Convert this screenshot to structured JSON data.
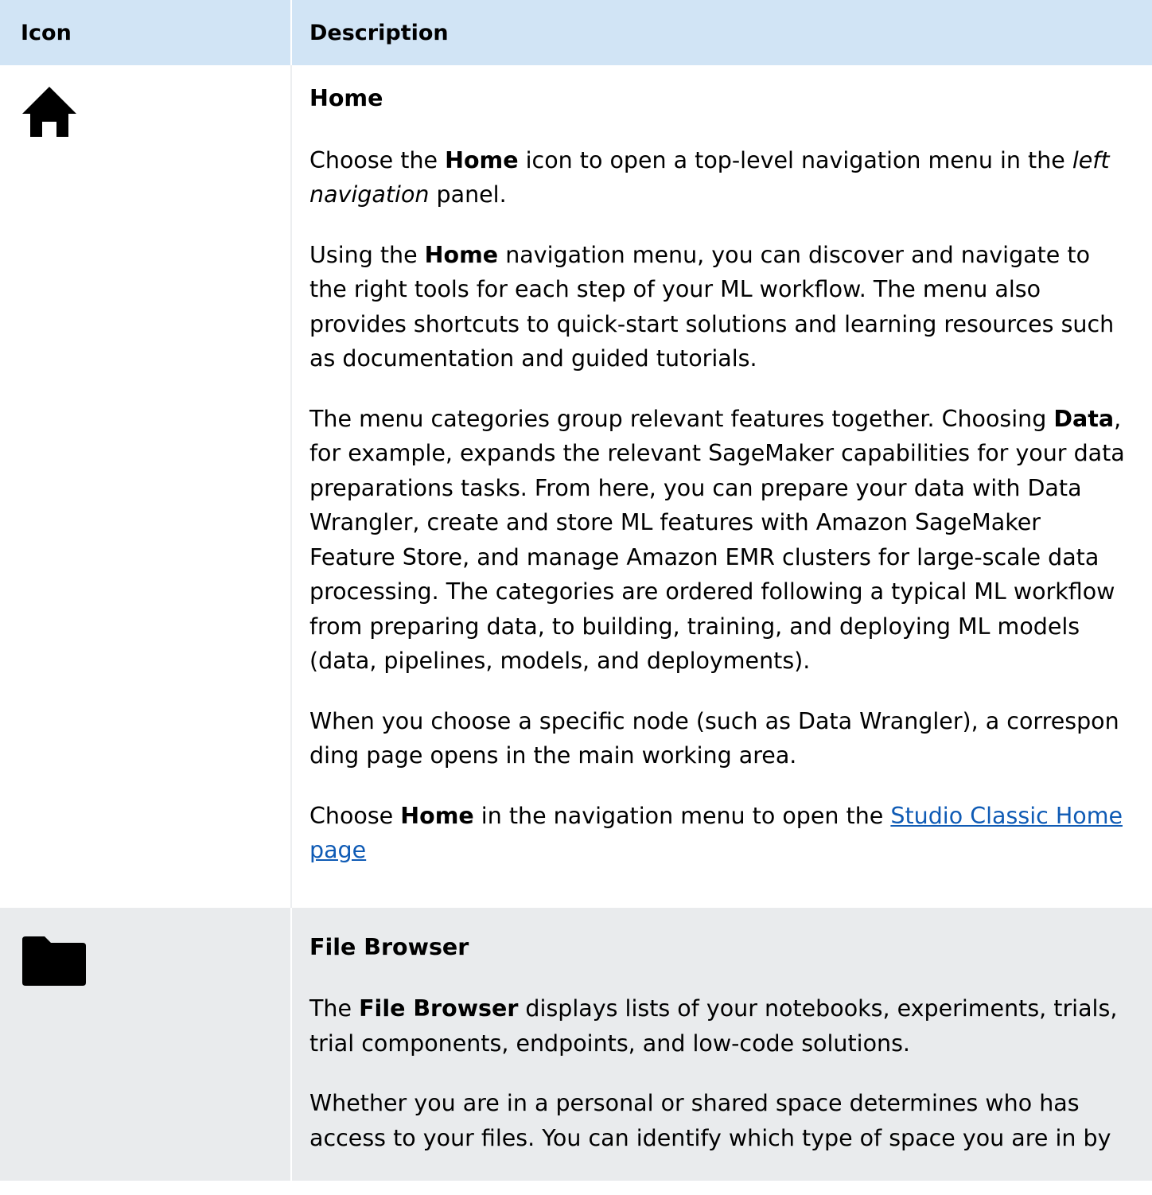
{
  "table": {
    "headers": {
      "icon": "Icon",
      "description": "Description"
    }
  },
  "home": {
    "icon_name": "home-icon",
    "title": "Home",
    "p1": {
      "a": "Choose the ",
      "b": "Home",
      "c": " icon to open a top-level navigation menu in the ",
      "d": "left navigation",
      "e": " panel."
    },
    "p2": {
      "a": "Using the ",
      "b": "Home",
      "c": " navigation menu, you can discover and navigate to the right tools for each step of your ML workflow. The menu also provides shortcuts to quick-start solutions and learning resources such as documentation and guided tutorials."
    },
    "p3": {
      "a": "The menu categories group relevant features together. Choosing ",
      "b": "Data",
      "c": ", for example, expands the relevant SageMaker capabilities for your data preparations tasks. From here, you can prepare your data with Data Wrangler, create and store ML features with Amazon SageMaker Feature Store, and manage Amazon EMR clusters for large-scale data processing. The categories are ordered following a typical ML workflow from preparing data, to building, training, and deploying ML models (data, pipelines, models, and deployments)."
    },
    "p4": {
      "a": "When you choose a specific node (such as Data Wrangler), a correspon ding page opens in the main working area."
    },
    "p5": {
      "a": "Choose ",
      "b": "Home",
      "c": " in the navigation menu to open the ",
      "link": "Studio Classic Home page"
    }
  },
  "file_browser": {
    "icon_name": "folder-icon",
    "title": "File Browser",
    "p1": {
      "a": "The ",
      "b": "File Browser",
      "c": " displays lists of your notebooks, experiments, trials, trial components, endpoints, and low-code solutions."
    },
    "p2": {
      "a": "Whether you are in a personal or shared space determines who has access to your files. You can identify which type of space you are in by"
    }
  },
  "colors": {
    "header_bg": "#d1e4f5",
    "shaded_row_bg": "#e9ebed",
    "link": "#0f5bb5"
  }
}
